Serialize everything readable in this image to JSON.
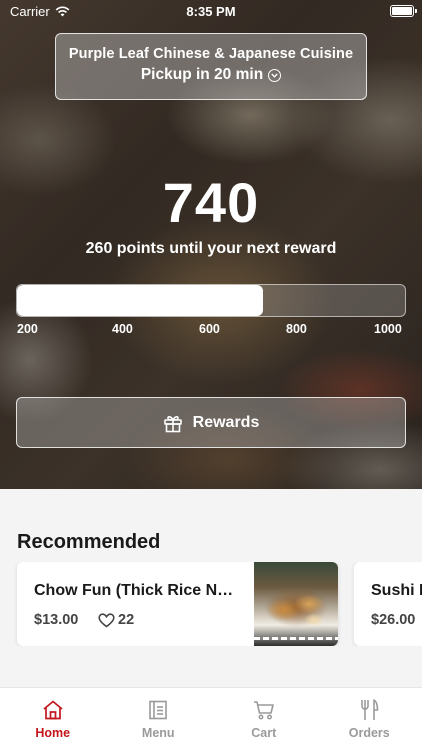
{
  "status_bar": {
    "carrier": "Carrier",
    "time": "8:35 PM"
  },
  "location": {
    "name": "Purple Leaf Chinese & Japanese Cuisine",
    "pickup": "Pickup in 20 min"
  },
  "points": {
    "value": "740",
    "subtitle": "260 points until your next reward",
    "progress_fraction": 0.635,
    "ticks": [
      "200",
      "400",
      "600",
      "800",
      "1000"
    ]
  },
  "rewards_button": {
    "label": "Rewards",
    "icon": "gift-icon"
  },
  "recommended": {
    "title": "Recommended",
    "items": [
      {
        "name": "Chow Fun (Thick Rice  N…",
        "price": "$13.00",
        "likes": "22",
        "like_icon": "heart-outline-icon"
      },
      {
        "name": "Sushi L",
        "price": "$26.00"
      }
    ]
  },
  "tabs": [
    {
      "label": "Home",
      "icon": "home-icon",
      "active": true
    },
    {
      "label": "Menu",
      "icon": "menu-book-icon",
      "active": false
    },
    {
      "label": "Cart",
      "icon": "cart-icon",
      "active": false
    },
    {
      "label": "Orders",
      "icon": "fork-knife-icon",
      "active": false
    }
  ],
  "colors": {
    "accent": "#c4161c",
    "tab_inactive": "#9a9a9a"
  }
}
